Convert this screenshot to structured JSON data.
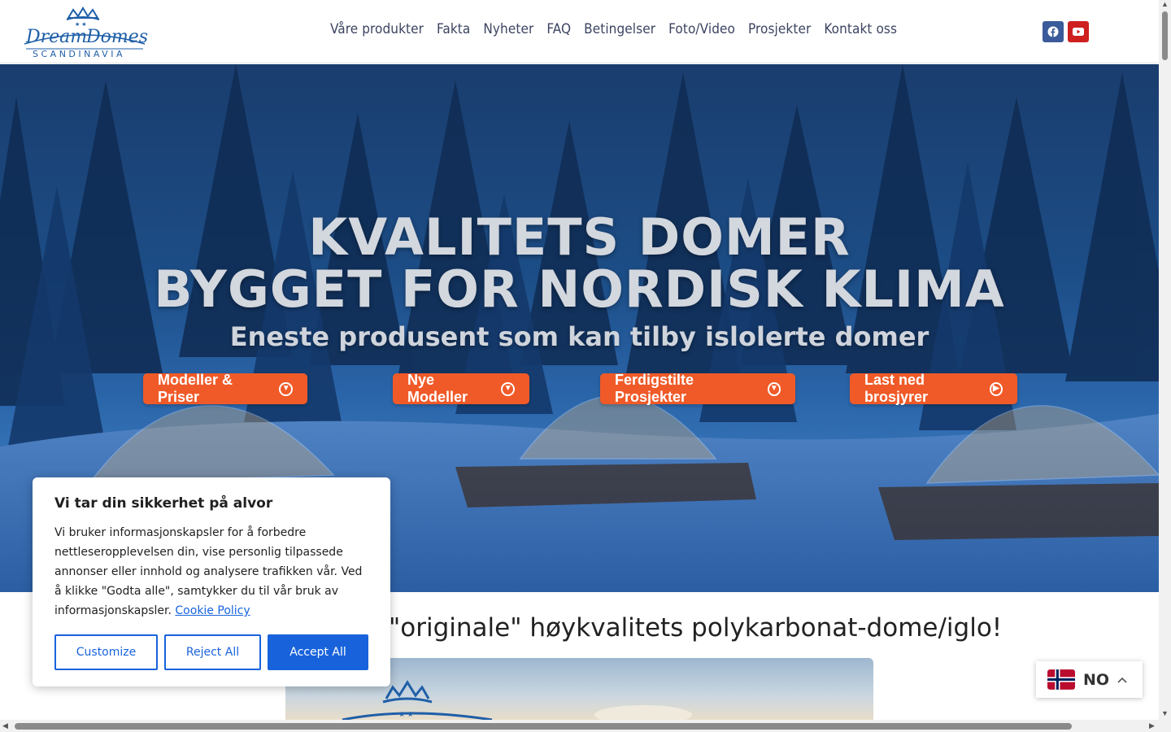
{
  "brand": {
    "logo_top": "Dream Domes",
    "logo_bottom": "SCANDINAVIA"
  },
  "nav": {
    "items": [
      "Våre produkter",
      "Fakta",
      "Nyheter",
      "FAQ",
      "Betingelser",
      "Foto/Video",
      "Prosjekter",
      "Kontakt oss"
    ]
  },
  "social": {
    "facebook": "facebook-icon",
    "youtube": "youtube-icon"
  },
  "hero": {
    "line1": "KVALITETS DOMER",
    "line2": "BYGGET FOR NORDISK KLIMA",
    "subtitle": "Eneste produsent som kan tilby islolerte domer",
    "buttons": [
      "Modeller & Priser",
      "Nye Modeller",
      "Ferdigstilte Prosjekter",
      "Last ned brosjyrer"
    ]
  },
  "section": {
    "tagline": "\"originale\" høykvalitets polykarbonat-dome/iglo!"
  },
  "cookie": {
    "title": "Vi tar din sikkerhet på alvor",
    "body": "Vi bruker informasjonskapsler for å forbedre nettleseropplevelsen din, vise personlig tilpassede annonser eller innhold og analysere trafikken vår. Ved å klikke \"Godta alle\", samtykker du til vår bruk av informasjonskapsler.",
    "policy_link": "Cookie Policy",
    "customize": "Customize",
    "reject": "Reject All",
    "accept": "Accept All"
  },
  "lang": {
    "code": "NO"
  },
  "colors": {
    "accent": "#f05a28",
    "cookie_blue": "#1863dc",
    "nav_text": "#3c4461"
  }
}
